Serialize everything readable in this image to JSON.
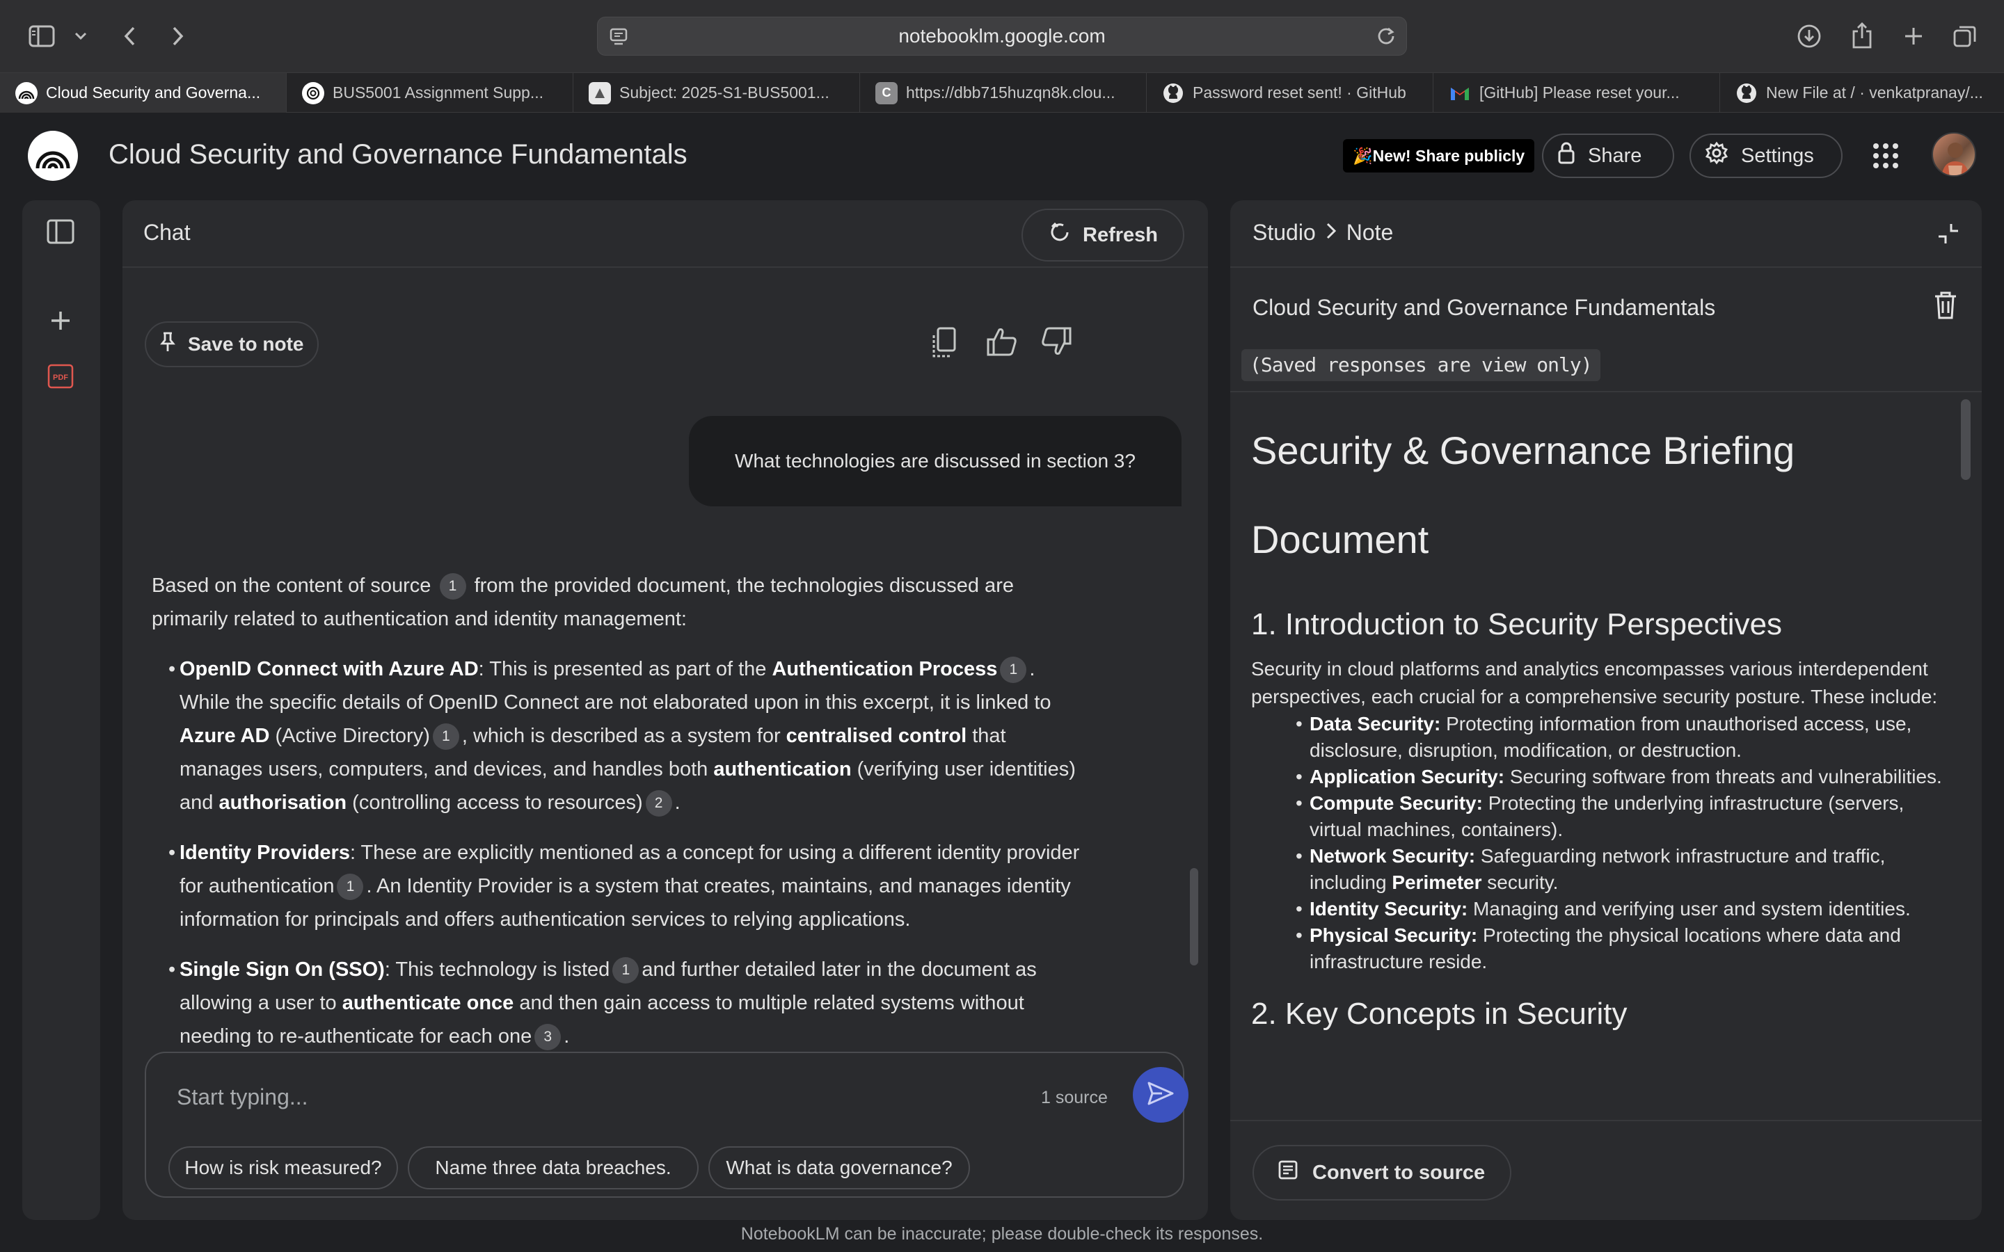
{
  "browser": {
    "url": "notebooklm.google.com",
    "tabs": [
      {
        "label": "Cloud Security and Governa...",
        "favicon": "notebooklm-icon",
        "active": true
      },
      {
        "label": "BUS5001 Assignment Supp...",
        "favicon": "openai-icon",
        "active": false
      },
      {
        "label": "Subject: 2025-S1-BUS5001...",
        "favicon": "lms-icon",
        "active": false
      },
      {
        "label": "https://dbb715huzqn8k.clou...",
        "favicon": "c-letter-icon",
        "favicon_text": "C",
        "active": false
      },
      {
        "label": "Password reset sent! · GitHub",
        "favicon": "github-icon",
        "active": false
      },
      {
        "label": "[GitHub] Please reset your...",
        "favicon": "gmail-icon",
        "active": false
      },
      {
        "label": "New File at / · venkatpranay/...",
        "favicon": "github-icon",
        "active": false
      }
    ]
  },
  "header": {
    "title": "Cloud Security and Governance Fundamentals",
    "new_share_label": "🎉New! Share publicly",
    "share_label": "Share",
    "settings_label": "Settings"
  },
  "chat": {
    "title": "Chat",
    "refresh_label": "Refresh",
    "save_to_note_label": "Save to note",
    "user_message": "What technologies are discussed in section 3?",
    "composer": {
      "placeholder": "Start typing...",
      "source_count": "1 source"
    },
    "suggestions": [
      "How is risk measured?",
      "Name three data breaches.",
      "What is data governance?"
    ]
  },
  "answer": {
    "intro_a": "Based on the content of source",
    "intro_cite": "1",
    "intro_b": "from the provided document, the technologies discussed are primarily related to authentication and identity management:",
    "b1": {
      "term": "OpenID Connect with Azure AD",
      "t1": ": This is presented as part of the ",
      "t1b": "Authentication Process",
      "c1": "1",
      "t2": ". While the specific details of OpenID Connect are not elaborated upon in this excerpt, it is linked to ",
      "t2b": "Azure AD",
      "t3": " (Active Directory)",
      "c2": "1",
      "t4": ", which is described as a system for ",
      "t4b": "centralised control",
      "t5": " that manages users, computers, and devices, and handles both ",
      "t5b": "authentication",
      "t6": " (verifying user identities) and ",
      "t6b": "authorisation",
      "t7": " (controlling access to resources)",
      "c3": "2",
      "t8": "."
    },
    "b2": {
      "term": "Identity Providers",
      "t1": ": These are explicitly mentioned as a concept for using a different identity provider for authentication",
      "c1": "1",
      "t2": ". An Identity Provider is a system that creates, maintains, and manages identity information for principals and offers authentication services to relying applications."
    },
    "b3": {
      "term": "Single Sign On (SSO)",
      "t1": ": This technology is listed",
      "c1": "1",
      "t2": "and further detailed later in the document as allowing a user to ",
      "t2b": "authenticate once",
      "t3": " and then gain access to multiple related systems without needing to re-authenticate for each one",
      "c2": "3",
      "t4": "."
    }
  },
  "studio": {
    "crumb_root": "Studio",
    "crumb_leaf": "Note",
    "note_title": "Cloud Security and Governance Fundamentals",
    "view_only": "(Saved responses are view only)",
    "convert_label": "Convert to source",
    "doc": {
      "h1_line1": "Security & Governance Briefing",
      "h1_line2": "Document",
      "s1_title": "1. Introduction to Security Perspectives",
      "s1_para": "Security in cloud platforms and analytics encompasses various interdependent perspectives, each crucial for a comprehensive security posture. These include:",
      "items": [
        {
          "term": "Data Security:",
          "desc": " Protecting information from unauthorised access, use, disclosure, disruption, modification, or destruction."
        },
        {
          "term": "Application Security:",
          "desc": " Securing software from threats and vulnerabilities."
        },
        {
          "term": "Compute Security:",
          "desc": " Protecting the underlying infrastructure (servers, virtual machines, containers)."
        },
        {
          "term": "Network Security:",
          "desc": " Safeguarding network infrastructure and traffic, including ",
          "bold2": "Perimeter",
          "desc2": " security."
        },
        {
          "term": "Identity Security:",
          "desc": " Managing and verifying user and system identities."
        },
        {
          "term": "Physical Security:",
          "desc": " Protecting the physical locations where data and infrastructure reside."
        }
      ],
      "s2_title": "2. Key Concepts in Security"
    }
  },
  "footer": {
    "disclaimer": "NotebookLM can be inaccurate; please double-check its responses."
  },
  "colors": {
    "background": "#1f2023",
    "panel": "#2a2b2e",
    "send_button": "#3c52bf"
  }
}
